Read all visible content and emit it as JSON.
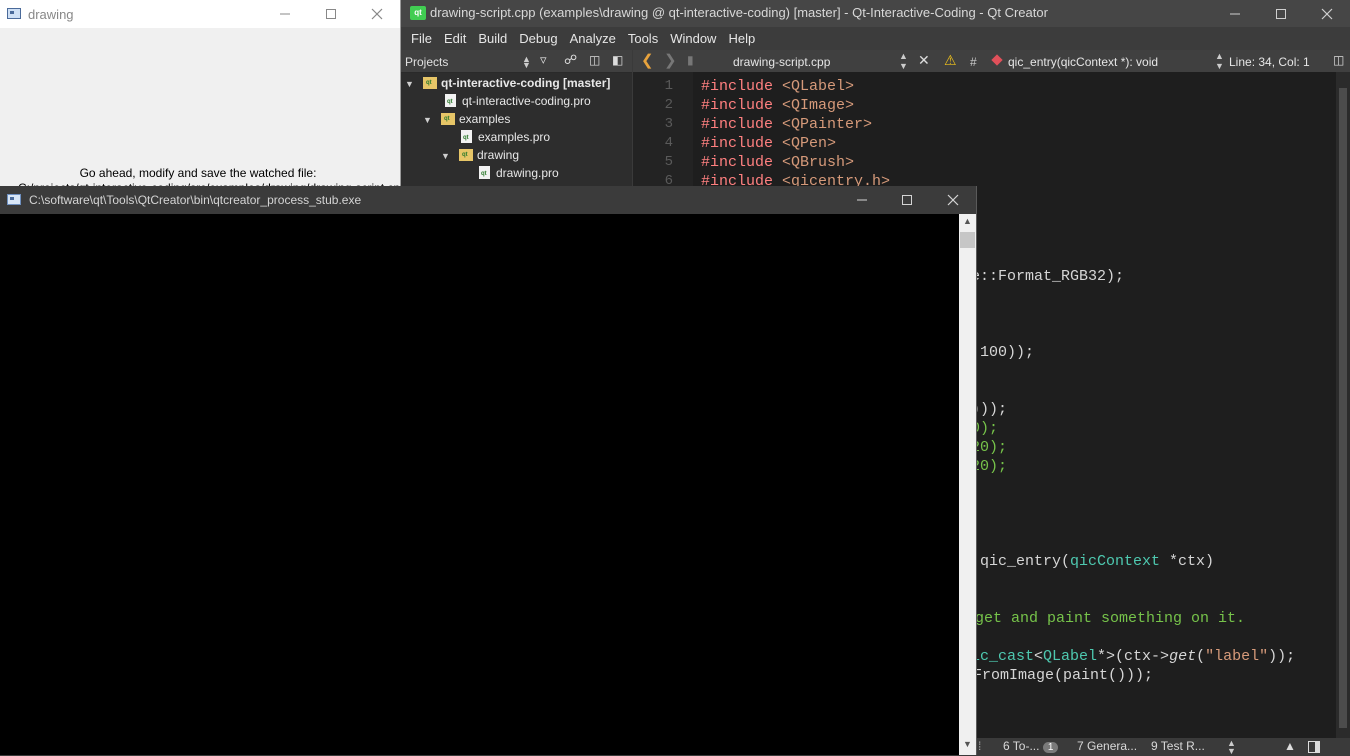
{
  "drawing_window": {
    "title": "drawing",
    "message_line1": "Go ahead, modify and save the watched file:",
    "message_line2": "C:/projects/qt-interactive-coding/src/examples/drawing/drawing-script.cpp"
  },
  "qtcreator": {
    "title": "drawing-script.cpp (examples\\drawing @ qt-interactive-coding) [master] - Qt-Interactive-Coding - Qt Creator",
    "logo_text": "qt",
    "menu": [
      "File",
      "Edit",
      "Build",
      "Debug",
      "Analyze",
      "Tools",
      "Window",
      "Help"
    ],
    "projects_label": "Projects",
    "tree": [
      {
        "label": "qt-interactive-coding [master]",
        "type": "folder",
        "expanded": true
      },
      {
        "label": "qt-interactive-coding.pro",
        "type": "file"
      },
      {
        "label": "examples",
        "type": "folder",
        "expanded": true
      },
      {
        "label": "examples.pro",
        "type": "file"
      },
      {
        "label": "drawing",
        "type": "folder",
        "expanded": true
      },
      {
        "label": "drawing.pro",
        "type": "file"
      }
    ],
    "editor_toolbar": {
      "file": "drawing-script.cpp",
      "hash": "#",
      "symbol": "qic_entry(qicContext *): void",
      "position": "Line: 34, Col: 1"
    },
    "line_numbers": [
      "1",
      "2",
      "3",
      "4",
      "5",
      "6"
    ],
    "code_lines": [
      {
        "kw": "#include ",
        "rest": "<QLabel>"
      },
      {
        "kw": "#include ",
        "rest": "<QImage>"
      },
      {
        "kw": "#include ",
        "rest": "<QPainter>"
      },
      {
        "kw": "#include ",
        "rest": "<QPen>"
      },
      {
        "kw": "#include ",
        "rest": "<QBrush>"
      },
      {
        "kw": "#include ",
        "rest": "<qicentry.h>"
      }
    ],
    "visible_code_fragments": {
      "format": "e::Format_RGB32);",
      "l100": "100));",
      "lsemi": ";",
      "g1": ")));",
      "g2": "0);",
      "g3": "20);",
      "g4": "20);",
      "entry_fn": "qic_entry",
      "entry_open": "(",
      "entry_type": "qicContext",
      "entry_arg": " *ctx)",
      "comment": "get and paint something on it.",
      "cast_a": "ic_cast",
      "cast_b": "<",
      "cast_type": "QLabel",
      "cast_c": "*>(ctx->",
      "cast_get": "get",
      "cast_d": "(",
      "cast_str": "\"label\"",
      "cast_e": "));",
      "from_image": "FromImage(paint()));"
    },
    "status": {
      "s6": "6  To-...",
      "badge": "1",
      "s7": "7  Genera...",
      "s9": "9  Test R..."
    }
  },
  "console": {
    "title": "C:\\software\\qt\\Tools\\QtCreator\\bin\\qtcreator_process_stub.exe"
  },
  "colors": {
    "keyword": "#ff8080",
    "string": "#d69a7a",
    "comment_green": "#76c34a",
    "type": "#4ec9b0",
    "editor_bg": "#1e1e1e"
  }
}
